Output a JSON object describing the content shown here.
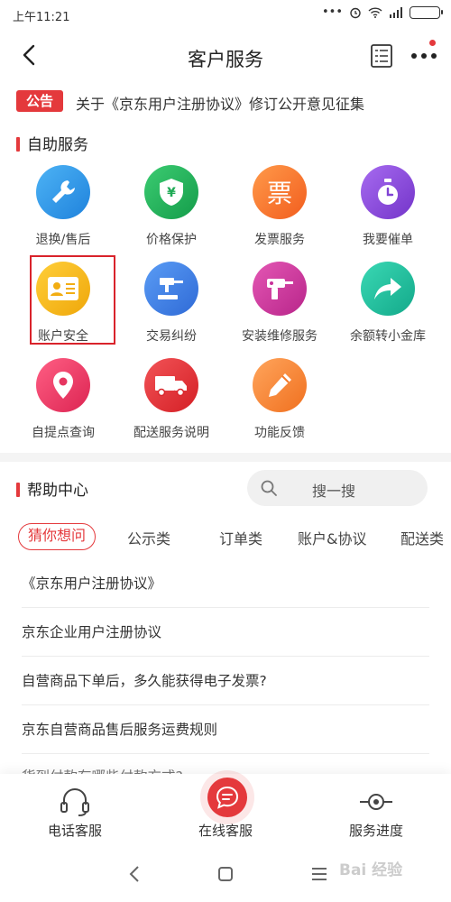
{
  "status_bar": {
    "time": "上午11:21",
    "battery_icon": "battery-icon",
    "wifi_icon": "wifi-icon"
  },
  "header": {
    "title": "客户服务"
  },
  "notice": {
    "tag": "公告",
    "text": "关于《京东用户注册协议》修订公开意见征集"
  },
  "self_service": {
    "title": "自助服务",
    "items": [
      {
        "label": "退换/售后",
        "icon": "wrench-icon",
        "color": "#2f96e8"
      },
      {
        "label": "价格保护",
        "icon": "shield-yen-icon",
        "color": "#22b35e"
      },
      {
        "label": "发票服务",
        "icon": "invoice-icon",
        "glyph": "票",
        "color": "#ff7a2d"
      },
      {
        "label": "我要催单",
        "icon": "timer-icon",
        "color": "#8a4fd8"
      },
      {
        "label": "账户安全",
        "icon": "id-card-icon",
        "color": "#f5b717"
      },
      {
        "label": "交易纠纷",
        "icon": "gavel-icon",
        "color": "#3d7fe0"
      },
      {
        "label": "安装维修服务",
        "icon": "drill-icon",
        "color": "#d63aa0"
      },
      {
        "label": "余额转小金库",
        "icon": "share-arrow-icon",
        "color": "#22c2a0"
      },
      {
        "label": "自提点查询",
        "icon": "location-pin-icon",
        "color": "#f03d6a"
      },
      {
        "label": "配送服务说明",
        "icon": "truck-icon",
        "color": "#e8353b"
      },
      {
        "label": "功能反馈",
        "icon": "pencil-icon",
        "color": "#ff8a3d"
      }
    ]
  },
  "help_center": {
    "title": "帮助中心",
    "search_placeholder": "搜一搜",
    "tabs": [
      "猜你想问",
      "公示类",
      "订单类",
      "账户&协议",
      "配送类"
    ],
    "questions": [
      "《京东用户注册协议》",
      "京东企业用户注册协议",
      "自营商品下单后，多久能获得电子发票?",
      "京东自营商品售后服务运费规则",
      "货到付款有哪些付款方式?"
    ]
  },
  "bottom_bar": {
    "phone": "电话客服",
    "online": "在线客服",
    "progress": "服务进度"
  },
  "watermark": "Bai 经验",
  "colors": {
    "accent": "#e4393c"
  }
}
